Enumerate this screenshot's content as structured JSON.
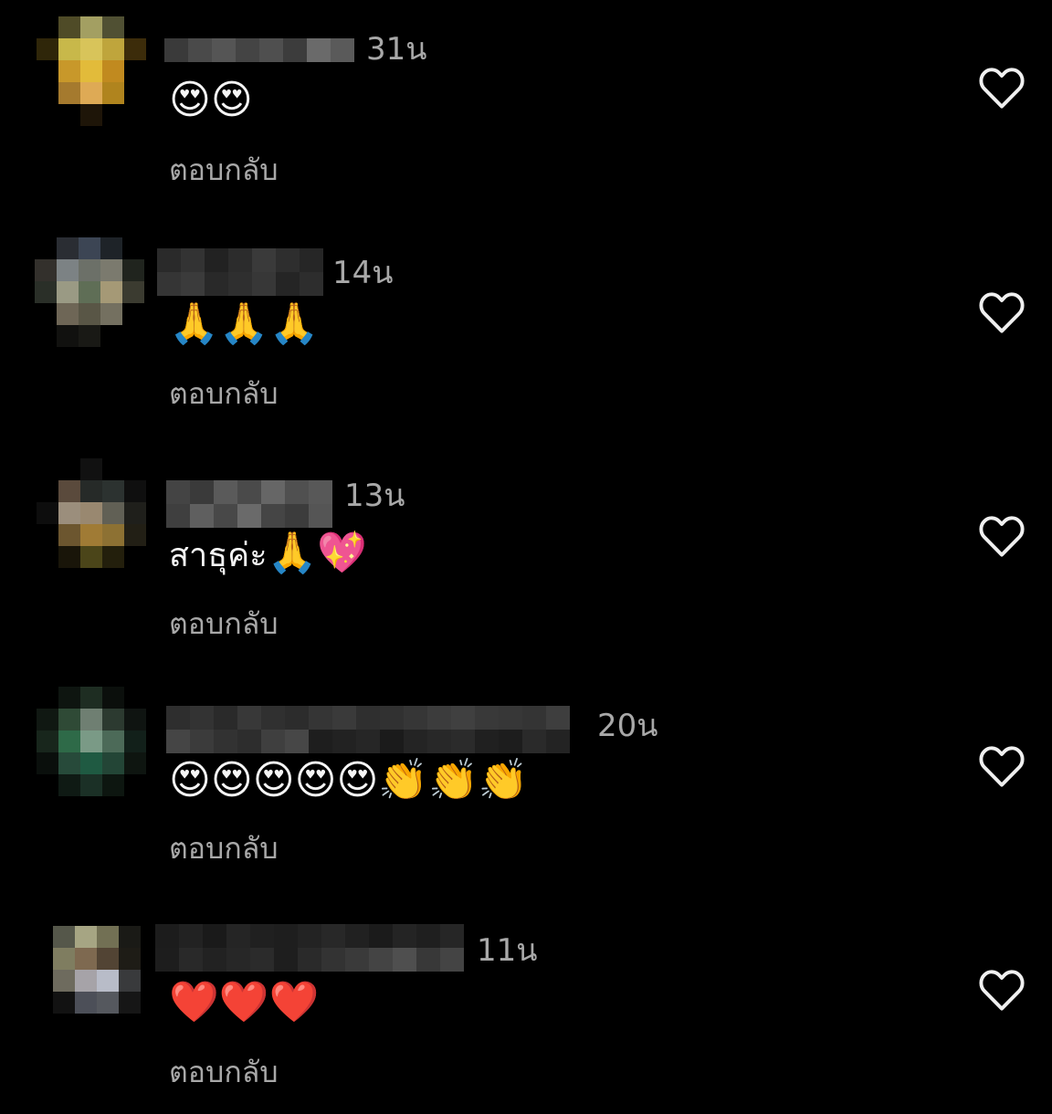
{
  "comments": [
    {
      "time": "31น",
      "body_text": "",
      "body_emoji": "😍😍",
      "reply_label": "ตอบกลับ",
      "avatar_colors": [
        "#000",
        "#4f4b27",
        "#a39f62",
        "#505033",
        "#000",
        "#2f2609",
        "#c8b84a",
        "#d8c45a",
        "#bfa53c",
        "#3c2c0a",
        "#000",
        "#c8982a",
        "#e2bb3a",
        "#c18a1f",
        "#000",
        "#000",
        "#a57a2e",
        "#deaa55",
        "#b0841e",
        "#000",
        "#000",
        "#000",
        "#1e1508",
        "#000",
        "#000"
      ],
      "name_colors": [
        "#3a3a3a",
        "#4a4a4a",
        "#555",
        "#444",
        "#4f4f4f",
        "#3c3c3c",
        "#6a6a6a",
        "#5a5a5a",
        "#707070",
        "#5c5c5c",
        "#3e3e3e",
        "#464646",
        "#4c4c4c",
        "#393939",
        "#505050",
        "#444",
        "#5b5b5b",
        "#404040",
        "#353535",
        "#3f3f3f",
        "#4b4b4b",
        "#585858",
        "#434343",
        "#3b3b3b",
        "#545454",
        "#3d3d3d",
        "#4e4e4e",
        "#474747",
        "#424242",
        "#363636",
        "#4d4d4d",
        "#5e5e5e",
        "#3a3a3a",
        "#515151"
      ]
    },
    {
      "time": "14น",
      "body_text": "",
      "body_emoji": "🙏🙏🙏",
      "reply_label": "ตอบกลับ",
      "avatar_colors": [
        "#000",
        "#2a2d33",
        "#3c4554",
        "#1e2328",
        "#000",
        "#33302c",
        "#7c8284",
        "#6c7068",
        "#7b7a6e",
        "#20241e",
        "#2a2f28",
        "#9a9a84",
        "#5f6e56",
        "#a59976",
        "#3b3b30",
        "#000",
        "#6e6656",
        "#595646",
        "#747060",
        "#000",
        "#000",
        "#11110f",
        "#191915",
        "#000",
        "#000"
      ],
      "name_colors": [
        "#2a2a2a",
        "#333",
        "#222",
        "#2c2c2c",
        "#3a3a3a",
        "#2e2e2e",
        "#262626",
        "#353535",
        "#3b3b3b",
        "#292929",
        "#2f2f2f",
        "#373737",
        "#252525",
        "#2d2d2d",
        "#3f3f3f",
        "#303030",
        "#242424",
        "#383838",
        "#2b2b2b",
        "#343434",
        "#282828",
        "#363636",
        "#323232",
        "#272727",
        "#393939",
        "#313131",
        "#2a2a2a",
        "#3c3c3c"
      ]
    },
    {
      "time": "13น",
      "body_text": "สาธุค่ะ",
      "body_emoji": "🙏💖",
      "reply_label": "ตอบกลับ",
      "avatar_colors": [
        "#000",
        "#000",
        "#111",
        "#000",
        "#000",
        "#000",
        "#5a4a3c",
        "#262a28",
        "#2c3230",
        "#0f0f0f",
        "#0d0d0d",
        "#9b8e7c",
        "#998870",
        "#616055",
        "#1f1f1b",
        "#000",
        "#6c562f",
        "#a07b35",
        "#8d7133",
        "#221f15",
        "#000",
        "#191509",
        "#4b4519",
        "#231f0c",
        "#000"
      ],
      "name_colors": [
        "#444",
        "#3a3a3a",
        "#5a5a5a",
        "#4a4a4a",
        "#666",
        "#505050",
        "#585858",
        "#3f3f3f",
        "#5f5f5f",
        "#484848",
        "#6a6a6a",
        "#454545",
        "#3c3c3c",
        "#555",
        "#4d4d4d",
        "#616161",
        "#404040",
        "#262626",
        "#181818",
        "#303030",
        "#222",
        "#2b2b2b",
        "#1a1a1a",
        "#282828",
        "#333",
        "#1e1e1e",
        "#2a2a2a",
        "#202020"
      ]
    },
    {
      "time": "20น",
      "body_text": "",
      "body_emoji": "😍😍😍😍😍👏👏👏",
      "reply_label": "ตอบกลับ",
      "avatar_colors": [
        "#000",
        "#0e1510",
        "#1e2d22",
        "#0b0f0c",
        "#000",
        "#101812",
        "#2f4a36",
        "#6f7f72",
        "#2c3a30",
        "#0f1411",
        "#18261c",
        "#2e6a48",
        "#7a9a86",
        "#4c6a58",
        "#12201a",
        "#0a0f0c",
        "#274a3a",
        "#1f5a42",
        "#234536",
        "#0e1510",
        "#000",
        "#0f1a14",
        "#1b3026",
        "#0d1610",
        "#000"
      ],
      "name_colors": [
        "#2e2e2e",
        "#333",
        "#2a2a2a",
        "#383838",
        "#303030",
        "#2c2c2c",
        "#353535",
        "#3a3a3a",
        "#2f2f2f",
        "#313131",
        "#363636",
        "#3c3c3c",
        "#404040",
        "#393939",
        "#373737",
        "#343434",
        "#3e3e3e",
        "#454545",
        "#3b3b3b",
        "#323232",
        "#2d2d2d",
        "#3f3f3f",
        "#474747",
        "#1e1e1e",
        "#222",
        "#262626",
        "#1b1b1b",
        "#242424",
        "#282828",
        "#2b2b2b",
        "#202020",
        "#1d1d1d",
        "#2a2a2a",
        "#232323",
        "#252525",
        "#1f1f1f",
        "#292929",
        "#222",
        "#2c2c2c",
        "#1e1e1e",
        "#262626",
        "#212121",
        "#2a2a2a",
        "#242424",
        "#2d2d2d",
        "#1f1f1f",
        "#282828",
        "#272727",
        "#333",
        "#222",
        "#2b2b2b",
        "#303030",
        "#252525",
        "#2e2e2e",
        "#202020",
        "#323232"
      ]
    },
    {
      "time": "11น",
      "body_text": "",
      "body_emoji": "❤️❤️❤️",
      "reply_label": "ตอบกลับ",
      "avatar_colors": [
        "#000",
        "#55574a",
        "#a6a583",
        "#727054",
        "#1a1a16",
        "#000",
        "#7f7d60",
        "#7e6950",
        "#524434",
        "#1e1c16",
        "#000",
        "#6e6b5e",
        "#a6a3a8",
        "#b8bcc8",
        "#393a3c",
        "#000",
        "#121212",
        "#4c4f58",
        "#55585e",
        "#161616",
        "#000",
        "#000",
        "#000",
        "#000",
        "#000"
      ],
      "name_colors": [
        "#1c1c1c",
        "#222",
        "#1a1a1a",
        "#252525",
        "#202020",
        "#1e1e1e",
        "#232323",
        "#282828",
        "#212121",
        "#1b1b1b",
        "#242424",
        "#1f1f1f",
        "#262626",
        "#1d1d1d",
        "#292929",
        "#222",
        "#272727",
        "#2b2b2b",
        "#1e1e1e",
        "#2a2a2a",
        "#333",
        "#3a3a3a",
        "#444",
        "#4f4f4f",
        "#383838",
        "#444",
        "#333",
        "#3c3c3c",
        "#454545",
        "#343434",
        "#3b3b3b",
        "#484848",
        "#363636",
        "#4a4a4a",
        "#3f3f3f",
        "#555",
        "#404040",
        "#5a5a5a",
        "#3d3d3d",
        "#505050"
      ]
    }
  ]
}
